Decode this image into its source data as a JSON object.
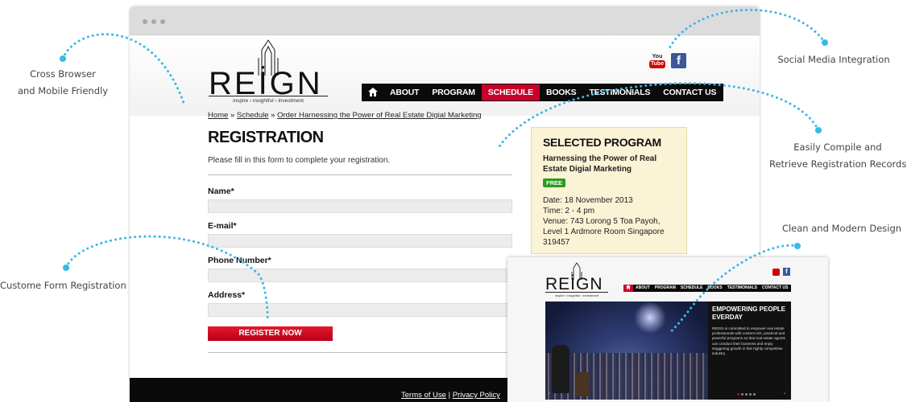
{
  "callouts": {
    "cross_browser_line1": "Cross Browser",
    "cross_browser_line2": "and Mobile Friendly",
    "social_media": "Social Media Integration",
    "compile_line1": "Easily Compile and",
    "compile_line2": "Retrieve Registration Records",
    "clean_design": "Clean and Modern Design",
    "custom_form": "Custome Form Registration"
  },
  "brand": {
    "logo_text": "REİGN",
    "tagline": "inspire › insightful › investment"
  },
  "social": {
    "youtube_top": "You",
    "youtube_bottom": "Tube",
    "facebook": "f"
  },
  "nav": {
    "home_icon": "home-icon",
    "items": [
      "ABOUT",
      "PROGRAM",
      "SCHEDULE",
      "BOOKS",
      "TESTIMONIALS",
      "CONTACT US"
    ],
    "active": "SCHEDULE"
  },
  "breadcrumb": {
    "home": "Home",
    "sep": " » ",
    "schedule": "Schedule",
    "current": "Order Harnessing the Power of Real Estate Digial Marketing"
  },
  "form": {
    "title": "REGISTRATION",
    "intro": "Please fill in this form to complete your registration.",
    "name_label": "Name*",
    "email_label": "E-mail*",
    "phone_label": "Phone Number*",
    "address_label": "Address*",
    "name_value": "",
    "email_value": "",
    "phone_value": "",
    "address_value": "",
    "submit": "REGISTER NOW"
  },
  "selected_program": {
    "heading": "SELECTED PROGRAM",
    "name": "Harnessing the Power of Real Estate Digial Marketing",
    "badge": "FREE",
    "date": "Date: 18 November 2013",
    "time": "Time: 2 - 4 pm",
    "venue": "Venue: 743 Lorong 5 Toa Payoh, Level 1 Ardmore Room Singapore 319457"
  },
  "footer": {
    "terms": "Terms of Use",
    "sep": " | ",
    "privacy": "Privacy Policy"
  },
  "preview": {
    "nav_items": [
      "ABOUT",
      "PROGRAM",
      "SCHEDULE",
      "BOOKS",
      "TESTIMONIALS",
      "CONTACT US"
    ],
    "hero_title": "EMPOWERING PEOPLE EVERDAY",
    "hero_text": "REIGN is committed to empower real estate professionals with content rich, practical and powerful programs so that real estate agents can conduct their business and enjoy staggering growth in this highly competitive industry."
  },
  "colors": {
    "accent_red": "#c8002c",
    "callout_dots": "#3bb8e6",
    "free_badge": "#2c9a1e",
    "facebook": "#3b5998"
  }
}
